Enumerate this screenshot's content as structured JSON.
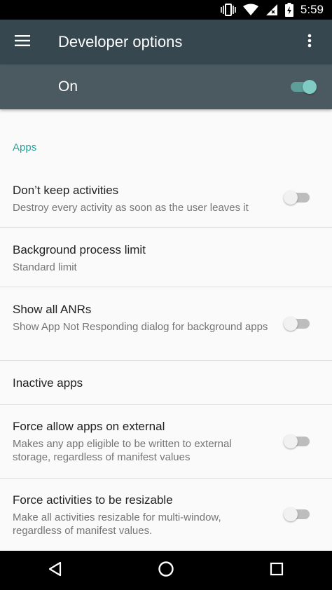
{
  "status_bar": {
    "time": "5:59",
    "icons": [
      "vibrate-icon",
      "wifi-icon",
      "signal-icon",
      "battery-icon"
    ]
  },
  "app_bar": {
    "title": "Developer options",
    "menu_icon": "hamburger-menu-icon",
    "overflow_icon": "more-vert-icon"
  },
  "master_switch": {
    "label": "On",
    "checked": true
  },
  "colors": {
    "app_bar": "#37474f",
    "master_bar": "#4b5a60",
    "accent": "#26a69a",
    "switch_on": "#80cbc4"
  },
  "category": "Apps",
  "preferences": [
    {
      "title": "Don’t keep activities",
      "summary": "Destroy every activity as soon as the user leaves it",
      "switch": false
    },
    {
      "title": "Background process limit",
      "summary": "Standard limit"
    },
    {
      "title": "Show all ANRs",
      "summary": "Show App Not Responding dialog for background apps",
      "switch": false
    },
    {
      "title": "Inactive apps"
    },
    {
      "title": "Force allow apps on external",
      "summary": "Makes any app eligible to be written to external storage, regardless of manifest values",
      "switch": false
    },
    {
      "title": "Force activities to be resizable",
      "summary": "Make all activities resizable for multi-window, regardless of manifest values.",
      "switch": false
    }
  ],
  "nav_bar": {
    "buttons": [
      "back-icon",
      "home-icon",
      "recents-icon"
    ]
  }
}
